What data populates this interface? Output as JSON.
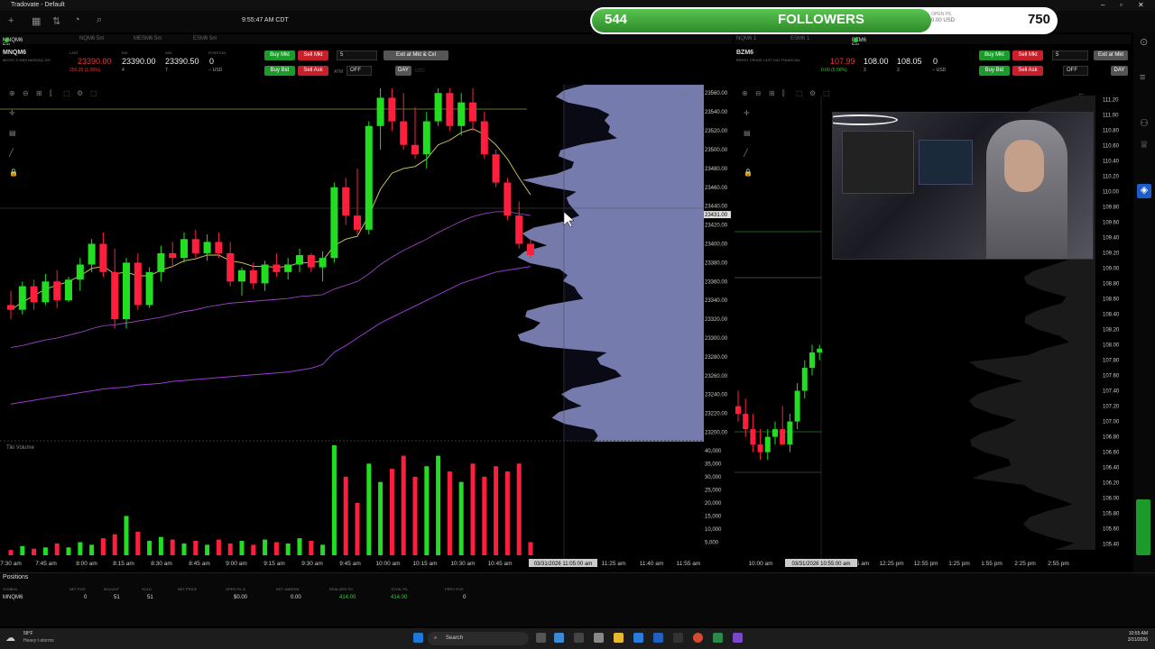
{
  "window": {
    "title": "Tradovate - Default",
    "clock": "9:55:47 AM CDT"
  },
  "banner": {
    "current": "544",
    "label": "FOLLOWERS",
    "goal": "750",
    "current_fraction": 0.725,
    "open_pl_label": "OPEN P/L",
    "open_pl_value": "0.00 USD"
  },
  "left": {
    "tabs": [
      "MNQM6 5m",
      "NQM6 5m",
      "MESM6 5m",
      "ESM6 5m"
    ],
    "symbol": "MNQM6",
    "description": "MICRO E-MINI NASDAQ 100",
    "last_label": "LAST",
    "last": "23390.00",
    "change": "250.25 (1.08%)",
    "bid_label": "BID",
    "bid": "23390.00",
    "bid_size": "4",
    "ask_label": "ASK",
    "ask": "23390.50",
    "ask_size": "7",
    "pos_label": "POSITION",
    "position": "0",
    "position_unit": "-- USD",
    "buy_mkt": "Buy Mkt",
    "sell_mkt": "Sell Mkt",
    "buy_bid": "Buy Bid",
    "sell_ask": "Sell Ask",
    "qty": "5",
    "exit": "Exit at Mkt & Cxl",
    "atm_label": "ATM",
    "atm": "OFF",
    "day": "DAY",
    "gtc": "GTC",
    "volume_label": "Tiki Volume",
    "crosshair_time": "03/31/2026 11:05:00 am"
  },
  "right": {
    "tabs": [
      "BZM6 5m",
      "NQM6 1",
      "ESM6 1"
    ],
    "symbol": "BZM6",
    "description": "BRENT CRUDE LAST DAY FINANCIAL",
    "last": "107.99",
    "change": "0.60 (0.56%)",
    "bid": "108.00",
    "bid_size": "3",
    "ask": "108.05",
    "ask_size": "2",
    "position": "0",
    "position_unit": "-- USD",
    "buy_mkt": "Buy Mkt",
    "sell_mkt": "Sell Mkt",
    "buy_bid": "Buy Bid",
    "sell_ask": "Sell Ask",
    "qty": "5",
    "exit": "Exit at Mkt",
    "atm": "OFF",
    "day": "DAY",
    "crosshair_time": "03/31/2026 10:55:00 am"
  },
  "positions": {
    "title": "Positions",
    "headers": [
      "SYMBOL",
      "NET POS",
      "BOUGHT",
      "SOLD",
      "NET PRICE",
      "OPEN P/L $",
      "INIT. MARGIN",
      "REALIZED P/L",
      "TOTAL P/L",
      "PREV POS"
    ],
    "row": [
      "MNQM6",
      "0",
      "51",
      "51",
      "",
      "$0.00",
      "0.00",
      "414.00",
      "414.00",
      "0"
    ]
  },
  "taskbar": {
    "weather_temp": "58°F",
    "weather_desc": "Heavy t-storms",
    "search": "Search",
    "time": "10:55 AM",
    "date": "3/31/2026"
  },
  "colors": {
    "up": "#22dd22",
    "down": "#ff1f3d",
    "profile": "#8a8fc8",
    "ema_fast": "#d8d060",
    "ema_slow": "#9a3ad0"
  },
  "chart_data": [
    {
      "type": "candlestick",
      "name": "MNQM6 5m",
      "ylim": [
        23190,
        23565
      ],
      "y_ticks": [
        "23560.00",
        "23540.00",
        "23520.00",
        "23500.00",
        "23480.00",
        "23460.00",
        "23440.00",
        "23431.00",
        "23420.00",
        "23400.00",
        "23380.00",
        "23360.00",
        "23340.00",
        "23320.00",
        "23300.00",
        "23280.00",
        "23260.00",
        "23240.00",
        "23220.00",
        "23200.00"
      ],
      "x_ticks": [
        "7:30 am",
        "7:45 am",
        "8:00 am",
        "8:15 am",
        "8:30 am",
        "8:45 am",
        "9:00 am",
        "9:15 am",
        "9:30 am",
        "9:45 am",
        "10:00 am",
        "10:15 am",
        "10:30 am",
        "10:45 am",
        "11:25 am",
        "11:40 am",
        "11:55 am"
      ],
      "last_price_marker": "23431.00",
      "candles": [
        [
          23335,
          23350,
          23320,
          23330
        ],
        [
          23330,
          23360,
          23325,
          23355
        ],
        [
          23355,
          23362,
          23330,
          23338
        ],
        [
          23338,
          23368,
          23335,
          23360
        ],
        [
          23360,
          23372,
          23332,
          23340
        ],
        [
          23340,
          23365,
          23338,
          23362
        ],
        [
          23362,
          23385,
          23350,
          23378
        ],
        [
          23378,
          23405,
          23370,
          23400
        ],
        [
          23400,
          23412,
          23365,
          23370
        ],
        [
          23370,
          23395,
          23310,
          23320
        ],
        [
          23320,
          23385,
          23310,
          23380
        ],
        [
          23380,
          23390,
          23330,
          23335
        ],
        [
          23335,
          23375,
          23332,
          23370
        ],
        [
          23370,
          23398,
          23360,
          23390
        ],
        [
          23390,
          23402,
          23375,
          23385
        ],
        [
          23385,
          23412,
          23380,
          23405
        ],
        [
          23405,
          23415,
          23385,
          23390
        ],
        [
          23390,
          23410,
          23382,
          23402
        ],
        [
          23402,
          23412,
          23385,
          23390
        ],
        [
          23390,
          23402,
          23355,
          23360
        ],
        [
          23360,
          23375,
          23345,
          23372
        ],
        [
          23372,
          23380,
          23352,
          23358
        ],
        [
          23358,
          23382,
          23350,
          23378
        ],
        [
          23378,
          23390,
          23365,
          23370
        ],
        [
          23370,
          23385,
          23362,
          23378
        ],
        [
          23378,
          23395,
          23370,
          23388
        ],
        [
          23388,
          23390,
          23370,
          23375
        ],
        [
          23375,
          23392,
          23360,
          23385
        ],
        [
          23385,
          23465,
          23380,
          23460
        ],
        [
          23460,
          23470,
          23420,
          23430
        ],
        [
          23430,
          23480,
          23410,
          23415
        ],
        [
          23415,
          23530,
          23410,
          23525
        ],
        [
          23525,
          23565,
          23500,
          23555
        ],
        [
          23555,
          23565,
          23520,
          23530
        ],
        [
          23530,
          23560,
          23500,
          23505
        ],
        [
          23505,
          23545,
          23490,
          23495
        ],
        [
          23495,
          23540,
          23480,
          23530
        ],
        [
          23530,
          23565,
          23525,
          23560
        ],
        [
          23560,
          23565,
          23520,
          23525
        ],
        [
          23525,
          23560,
          23515,
          23550
        ],
        [
          23550,
          23565,
          23520,
          23530
        ],
        [
          23530,
          23540,
          23490,
          23495
        ],
        [
          23495,
          23500,
          23460,
          23465
        ],
        [
          23465,
          23470,
          23425,
          23430
        ],
        [
          23430,
          23445,
          23395,
          23400
        ],
        [
          23400,
          23405,
          23385,
          23388
        ]
      ],
      "volume_ylim": [
        0,
        42000
      ],
      "volume_ticks": [
        "40,000",
        "35,000",
        "30,000",
        "25,000",
        "20,000",
        "15,000",
        "10,000",
        "5,000"
      ],
      "volume": [
        2000,
        3500,
        2500,
        3000,
        4500,
        3000,
        5000,
        4000,
        6500,
        8000,
        15000,
        9000,
        5500,
        7000,
        6000,
        4500,
        5500,
        4000,
        6000,
        4500,
        5500,
        4000,
        6000,
        5000,
        4500,
        6500,
        5500,
        4000,
        42000,
        30000,
        20000,
        35000,
        28000,
        33000,
        38000,
        30000,
        34000,
        38000,
        32000,
        28000,
        35000,
        30000,
        34000,
        32000,
        35000,
        5000
      ],
      "ema_fast": [
        23330,
        23338,
        23345,
        23352,
        23356,
        23360,
        23366,
        23374,
        23376,
        23368,
        23370,
        23366,
        23366,
        23372,
        23376,
        23382,
        23384,
        23388,
        23388,
        23382,
        23380,
        23376,
        23376,
        23375,
        23376,
        23380,
        23380,
        23382,
        23398,
        23405,
        23408,
        23430,
        23458,
        23475,
        23480,
        23482,
        23490,
        23505,
        23510,
        23518,
        23522,
        23516,
        23505,
        23490,
        23470,
        23452
      ],
      "ema_slow": [
        23290,
        23292,
        23295,
        23298,
        23300,
        23303,
        23306,
        23310,
        23313,
        23314,
        23316,
        23318,
        23320,
        23322,
        23325,
        23328,
        23330,
        23333,
        23335,
        23337,
        23338,
        23339,
        23340,
        23341,
        23342,
        23344,
        23345,
        23346,
        23352,
        23356,
        23360,
        23368,
        23378,
        23386,
        23393,
        23399,
        23405,
        23412,
        23418,
        23424,
        23429,
        23432,
        23434,
        23434,
        23432,
        23430
      ],
      "vwap": [
        23230,
        23232,
        23234,
        23236,
        23238,
        23240,
        23242,
        23244,
        23246,
        23247,
        23248,
        23250,
        23251,
        23252,
        23254,
        23255,
        23256,
        23257,
        23258,
        23259,
        23260,
        23261,
        23262,
        23263,
        23264,
        23266,
        23268,
        23272,
        23285,
        23292,
        23300,
        23308,
        23316,
        23322,
        23328,
        23334,
        23340,
        23346,
        23352,
        23358,
        23362,
        23366,
        23370,
        23372,
        23374,
        23376
      ]
    },
    {
      "type": "candlestick",
      "name": "BZM6 5m",
      "ylim": [
        105.35,
        111.25
      ],
      "y_ticks": [
        "111.20",
        "111.00",
        "110.80",
        "110.60",
        "110.40",
        "110.20",
        "110.00",
        "109.80",
        "109.60",
        "109.40",
        "109.20",
        "109.00",
        "108.80",
        "108.60",
        "108.40",
        "108.20",
        "108.00",
        "107.80",
        "107.60",
        "107.40",
        "107.20",
        "107.00",
        "106.80",
        "106.60",
        "106.40",
        "106.20",
        "106.00",
        "105.80",
        "105.60",
        "105.40"
      ],
      "x_ticks": [
        "10:00 am",
        "11:55 am",
        "12:25 pm",
        "12:55 pm",
        "1:25 pm",
        "1:55 pm",
        "2:25 pm",
        "2:55 pm"
      ],
      "candles": [
        [
          107.2,
          107.4,
          107.0,
          107.1
        ],
        [
          107.1,
          107.3,
          106.8,
          106.9
        ],
        [
          106.9,
          107.1,
          106.6,
          106.7
        ],
        [
          106.7,
          106.9,
          106.5,
          106.6
        ],
        [
          106.6,
          106.9,
          106.5,
          106.8
        ],
        [
          106.8,
          107.0,
          106.7,
          106.9
        ],
        [
          106.9,
          107.2,
          106.8,
          106.7
        ],
        [
          106.7,
          107.1,
          106.6,
          107.0
        ],
        [
          107.0,
          107.5,
          106.9,
          107.4
        ],
        [
          107.4,
          107.8,
          107.3,
          107.7
        ],
        [
          107.7,
          108.0,
          107.6,
          107.9
        ],
        [
          107.9,
          108.0,
          107.8,
          107.95
        ]
      ]
    }
  ]
}
